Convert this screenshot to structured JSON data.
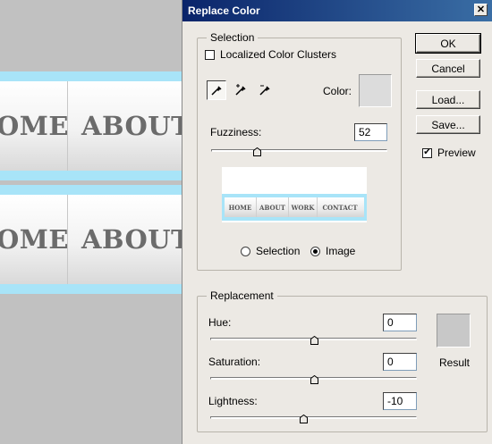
{
  "canvas": {
    "rows": [
      {
        "home": "OME",
        "about": "ABOUT"
      },
      {
        "home": "OME",
        "about": "ABOUT"
      }
    ]
  },
  "dialog": {
    "title": "Replace Color",
    "close_glyph": "✕",
    "buttons": {
      "ok": "OK",
      "cancel": "Cancel",
      "load": "Load...",
      "save": "Save..."
    },
    "preview_label": "Preview",
    "preview_checked": true,
    "selection": {
      "legend": "Selection",
      "localized_label": "Localized Color Clusters",
      "localized_checked": false,
      "color_label": "Color:",
      "color_value": "#dcdcdc",
      "fuzziness_label": "Fuzziness:",
      "fuzziness_value": "52",
      "fuzziness_level": 0.26,
      "preview_nav": [
        "HOME",
        "ABOUT",
        "WORK",
        "CONTACT"
      ],
      "radio_selection": "Selection",
      "radio_image": "Image",
      "selected_mode": "image"
    },
    "replacement": {
      "legend": "Replacement",
      "hue_label": "Hue:",
      "hue_value": "0",
      "hue_level": 0.5,
      "saturation_label": "Saturation:",
      "saturation_value": "0",
      "saturation_level": 0.5,
      "lightness_label": "Lightness:",
      "lightness_value": "-10",
      "lightness_level": 0.45,
      "result_label": "Result",
      "result_color": "#c8c8c8"
    }
  }
}
